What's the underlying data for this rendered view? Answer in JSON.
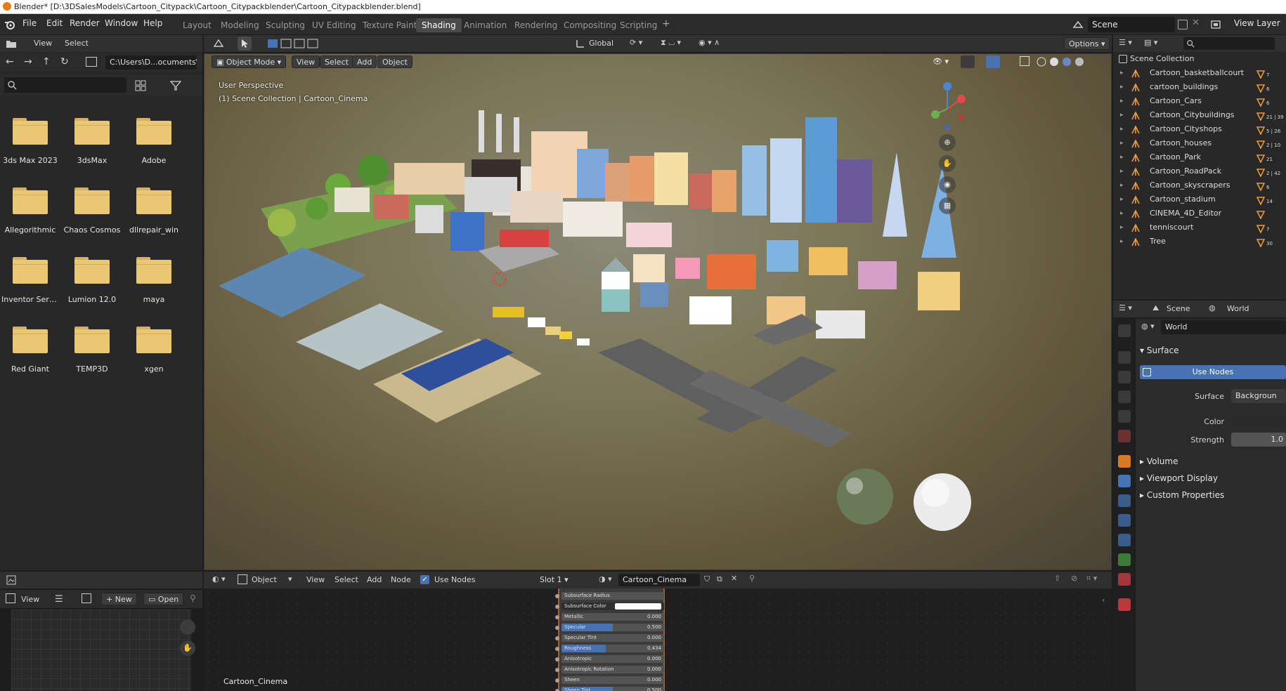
{
  "window_title": "Blender* [D:\\3DSalesModels\\Cartoon_Citypack\\Cartoon_Citypackblender\\Cartoon_Citypackblender.blend]",
  "menu": [
    "File",
    "Edit",
    "Render",
    "Window",
    "Help"
  ],
  "workspaces": [
    "Layout",
    "Modeling",
    "Sculpting",
    "UV Editing",
    "Texture Paint",
    "Shading",
    "Animation",
    "Rendering",
    "Compositing",
    "Scripting"
  ],
  "active_workspace": "Shading",
  "scene_name": "Scene",
  "view_layer": "View Layer",
  "file_browser": {
    "view_label": "View",
    "select_label": "Select",
    "path": "C:\\Users\\D...ocuments\\",
    "folders": [
      "3ds Max 2023",
      "3dsMax",
      "Adobe",
      "Allegorithmic",
      "Chaos Cosmos",
      "dllrepair_win",
      "Inventor Serv...",
      "Lumion 12.0",
      "maya",
      "Red Giant",
      "TEMP3D",
      "xgen"
    ]
  },
  "viewport": {
    "mode": "Object Mode",
    "menus": [
      "View",
      "Select",
      "Add",
      "Object"
    ],
    "transform_orientation": "Global",
    "options_label": "Options",
    "perspective_label": "User Perspective",
    "collection_label": "(1) Scene Collection | Cartoon_Cinema"
  },
  "outliner": {
    "root": "Scene Collection",
    "items": [
      {
        "name": "Cartoon_basketballcourt",
        "count": "7"
      },
      {
        "name": "cartoon_buildings",
        "count": "6"
      },
      {
        "name": "Cartoon_Cars",
        "count": "6"
      },
      {
        "name": "Cartoon_Citybuildings",
        "count": "21 | 39"
      },
      {
        "name": "Cartoon_Cityshops",
        "count": "5 | 26"
      },
      {
        "name": "Cartoon_houses",
        "count": "2 | 10"
      },
      {
        "name": "Cartoon_Park",
        "count": "21"
      },
      {
        "name": "Cartoon_RoadPack",
        "count": "2 | 42"
      },
      {
        "name": "Cartoon_skyscrapers",
        "count": "6"
      },
      {
        "name": "Cartoon_stadium",
        "count": "14"
      },
      {
        "name": "CINEMA_4D_Editor",
        "count": ""
      },
      {
        "name": "tenniscourt",
        "count": "7"
      },
      {
        "name": "Tree",
        "count": "30"
      }
    ]
  },
  "properties": {
    "context_scene": "Scene",
    "context_world": "World",
    "world_name": "World",
    "surface_section": "Surface",
    "use_nodes_label": "Use Nodes",
    "surface_label": "Surface",
    "surface_value": "Backgroun",
    "color_label": "Color",
    "strength_label": "Strength",
    "strength_value": "1.0",
    "collapsed_sections": [
      "Volume",
      "Viewport Display",
      "Custom Properties"
    ]
  },
  "image_editor": {
    "view_label": "View",
    "new_label": "New",
    "open_label": "Open"
  },
  "node_editor": {
    "object_label": "Object",
    "menus": [
      "View",
      "Select",
      "Add",
      "Node"
    ],
    "use_nodes_label": "Use Nodes",
    "slot_label": "Slot 1",
    "material_name": "Cartoon_Cinema",
    "footer_label": "Cartoon_Cinema",
    "params": [
      {
        "label": "Subsurface Radius",
        "value": "",
        "fill": 0
      },
      {
        "label": "Subsurface Color",
        "value": "",
        "fill": 0
      },
      {
        "label": "Metallic",
        "value": "0.000",
        "fill": 0
      },
      {
        "label": "Specular",
        "value": "0.500",
        "fill": 0.5
      },
      {
        "label": "Specular Tint",
        "value": "0.000",
        "fill": 0
      },
      {
        "label": "Roughness",
        "value": "0.434",
        "fill": 0.434
      },
      {
        "label": "Anisotropic",
        "value": "0.000",
        "fill": 0
      },
      {
        "label": "Anisotropic Rotation",
        "value": "0.000",
        "fill": 0
      },
      {
        "label": "Sheen",
        "value": "0.000",
        "fill": 0
      },
      {
        "label": "Sheen Tint",
        "value": "0.500",
        "fill": 0.5
      }
    ]
  },
  "colors": {
    "accent_blue": "#4772b3",
    "folder_yellow": "#e9c774",
    "outliner_orange": "#e89a3c"
  }
}
